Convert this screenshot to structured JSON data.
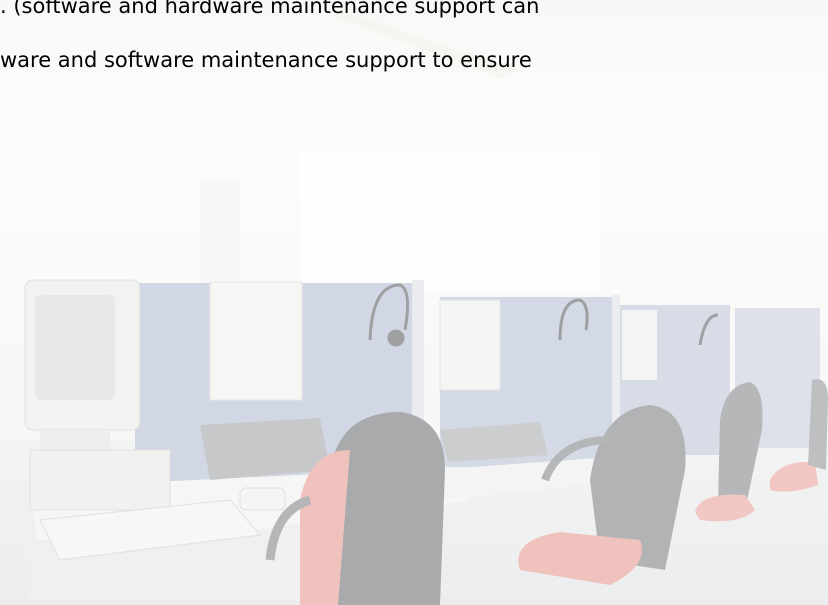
{
  "text": {
    "line1": ". (software and hardware maintenance support can",
    "line2": "ware and software maintenance support to ensure"
  },
  "scene": {
    "subject": "office call center with cubicles, computers, phones, headsets and chairs",
    "colors": {
      "background": "#fbfbfa",
      "cubicle_panel": "#b9c2d6",
      "chair_seat": "#e9a19c",
      "chair_back": "#7b7d80",
      "chair_frame": "#8d8f92",
      "desk": "#f2f2f1"
    }
  }
}
